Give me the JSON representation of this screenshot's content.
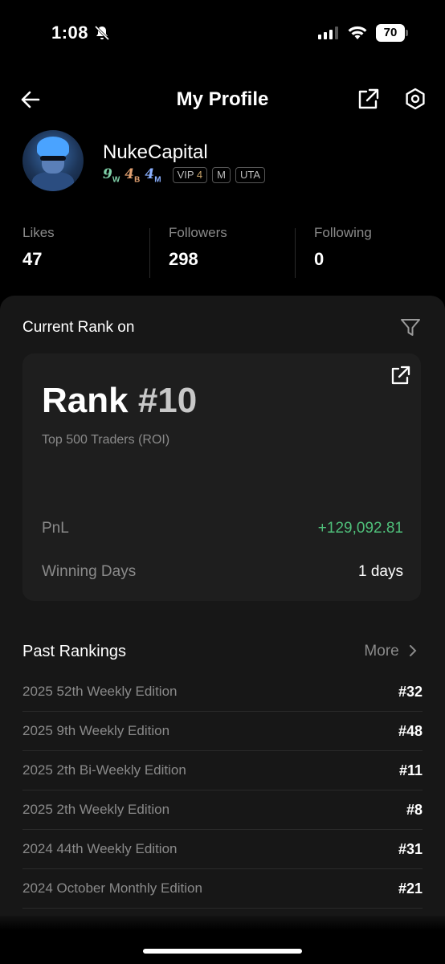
{
  "status_bar": {
    "time": "1:08",
    "battery": "70"
  },
  "nav": {
    "title": "My Profile"
  },
  "profile": {
    "username": "NukeCapital",
    "levels": [
      {
        "num": "9",
        "sub": "W",
        "color": "#7fd0a8"
      },
      {
        "num": "4",
        "sub": "B",
        "color": "#e0a070"
      },
      {
        "num": "4",
        "sub": "M",
        "color": "#8ab0ff"
      }
    ],
    "vip_label": "VIP",
    "vip_level": "4",
    "tags": [
      "M",
      "UTA"
    ]
  },
  "stats": [
    {
      "label": "Likes",
      "value": "47"
    },
    {
      "label": "Followers",
      "value": "298"
    },
    {
      "label": "Following",
      "value": "0"
    }
  ],
  "current_rank": {
    "heading": "Current Rank on",
    "rank_prefix": "Rank",
    "rank_number": "#10",
    "subtitle": "Top 500 Traders (ROI)",
    "pnl_label": "PnL",
    "pnl_value": "+129,092.81",
    "winning_days_label": "Winning Days",
    "winning_days_value": "1 days"
  },
  "past_rankings": {
    "heading": "Past Rankings",
    "more_label": "More",
    "items": [
      {
        "edition": "2025 52th Weekly Edition",
        "rank": "#32"
      },
      {
        "edition": "2025 9th Weekly Edition",
        "rank": "#48"
      },
      {
        "edition": "2025 2th Bi-Weekly Edition",
        "rank": "#11"
      },
      {
        "edition": "2025 2th Weekly Edition",
        "rank": "#8"
      },
      {
        "edition": "2024 44th Weekly Edition",
        "rank": "#31"
      },
      {
        "edition": "2024 October Monthly Edition",
        "rank": "#21"
      }
    ]
  },
  "colors": {
    "positive": "#4fbf7a",
    "vip": "#c9a46b",
    "panel": "#171717"
  }
}
